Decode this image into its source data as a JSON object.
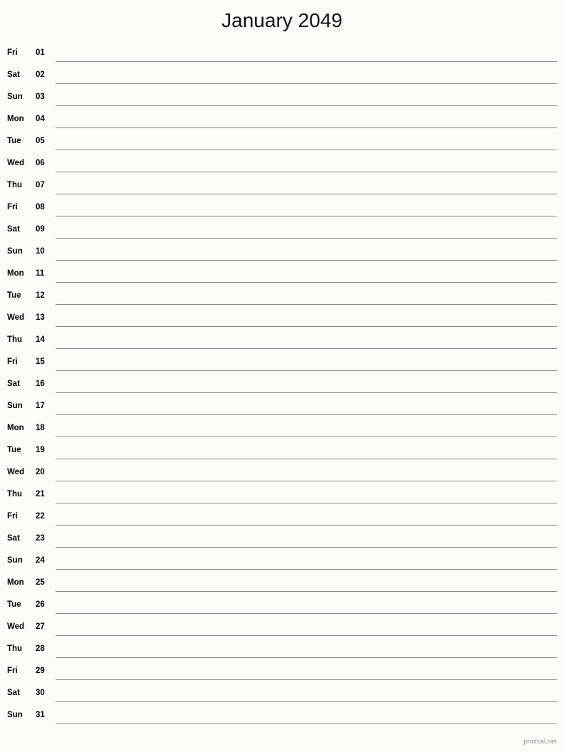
{
  "header": {
    "title": "January 2049",
    "month": "January",
    "year": "2049"
  },
  "footer": {
    "credit": "printcal.net"
  },
  "colors": {
    "background": "#fcfdf7",
    "text": "#000000",
    "rule_line": "#8a8a84",
    "footer_text": "#8d8d8d"
  },
  "calendar": {
    "layout": "single-column-notes",
    "days_count": 31,
    "rows": [
      {
        "weekday": "Fri",
        "date": "01"
      },
      {
        "weekday": "Sat",
        "date": "02"
      },
      {
        "weekday": "Sun",
        "date": "03"
      },
      {
        "weekday": "Mon",
        "date": "04"
      },
      {
        "weekday": "Tue",
        "date": "05"
      },
      {
        "weekday": "Wed",
        "date": "06"
      },
      {
        "weekday": "Thu",
        "date": "07"
      },
      {
        "weekday": "Fri",
        "date": "08"
      },
      {
        "weekday": "Sat",
        "date": "09"
      },
      {
        "weekday": "Sun",
        "date": "10"
      },
      {
        "weekday": "Mon",
        "date": "11"
      },
      {
        "weekday": "Tue",
        "date": "12"
      },
      {
        "weekday": "Wed",
        "date": "13"
      },
      {
        "weekday": "Thu",
        "date": "14"
      },
      {
        "weekday": "Fri",
        "date": "15"
      },
      {
        "weekday": "Sat",
        "date": "16"
      },
      {
        "weekday": "Sun",
        "date": "17"
      },
      {
        "weekday": "Mon",
        "date": "18"
      },
      {
        "weekday": "Tue",
        "date": "19"
      },
      {
        "weekday": "Wed",
        "date": "20"
      },
      {
        "weekday": "Thu",
        "date": "21"
      },
      {
        "weekday": "Fri",
        "date": "22"
      },
      {
        "weekday": "Sat",
        "date": "23"
      },
      {
        "weekday": "Sun",
        "date": "24"
      },
      {
        "weekday": "Mon",
        "date": "25"
      },
      {
        "weekday": "Tue",
        "date": "26"
      },
      {
        "weekday": "Wed",
        "date": "27"
      },
      {
        "weekday": "Thu",
        "date": "28"
      },
      {
        "weekday": "Fri",
        "date": "29"
      },
      {
        "weekday": "Sat",
        "date": "30"
      },
      {
        "weekday": "Sun",
        "date": "31"
      }
    ]
  }
}
